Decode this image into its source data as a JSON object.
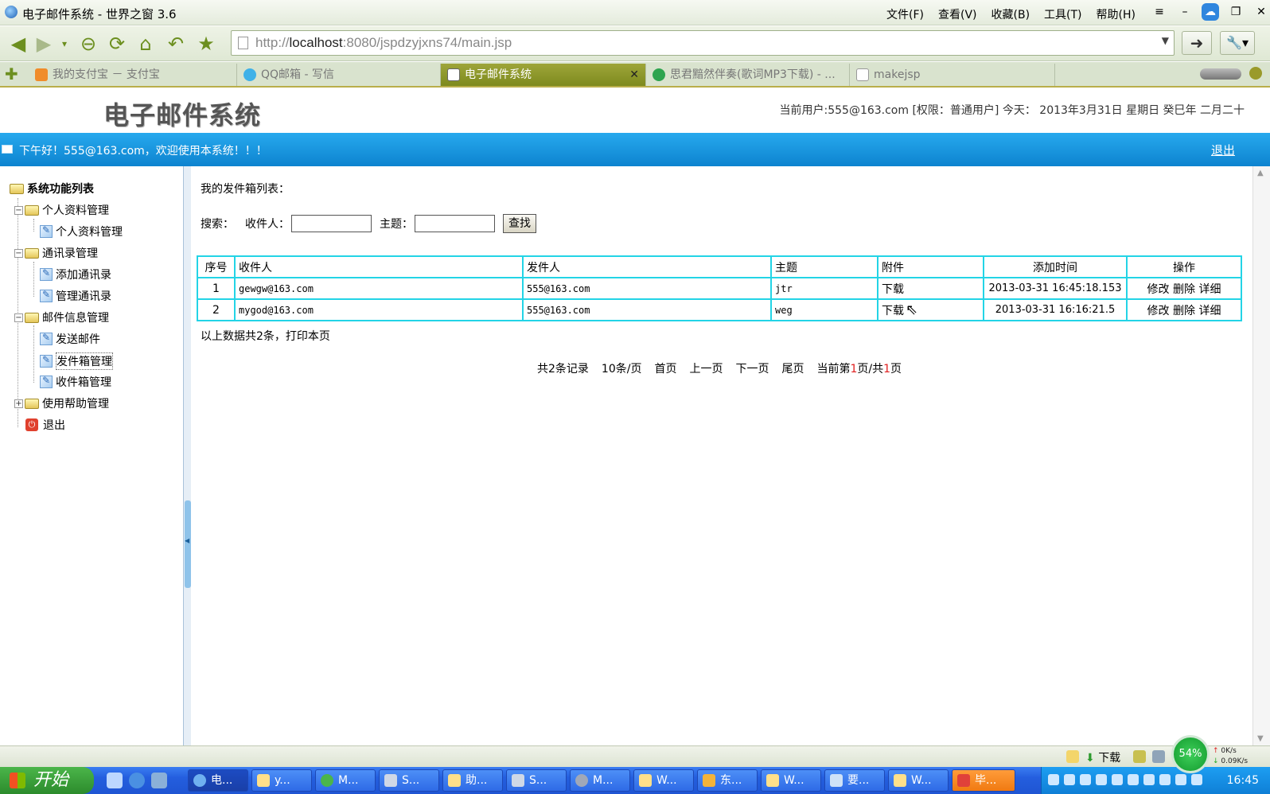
{
  "browser": {
    "title": "电子邮件系统 - 世界之窗 3.6",
    "menus": [
      "文件(F)",
      "查看(V)",
      "收藏(B)",
      "工具(T)",
      "帮助(H)"
    ],
    "url_prefix": "http://",
    "url_host": "localhost",
    "url_rest": ":8080/jspdzyjxns74/main.jsp",
    "tabs": [
      {
        "label": "我的支付宝 － 支付宝",
        "icon": "alipay-icon"
      },
      {
        "label": "QQ邮箱 - 写信",
        "icon": "qq-mail-icon"
      },
      {
        "label": "电子邮件系统",
        "icon": "page-icon",
        "active": true
      },
      {
        "label": "思君黯然伴奏(歌词MP3下载) - ...",
        "icon": "music-icon"
      },
      {
        "label": "makejsp",
        "icon": "page-icon"
      }
    ]
  },
  "site": {
    "logo": "电子邮件系统",
    "userinfo": "当前用户:555@163.com [权限：普通用户] 今天： 2013年3月31日 星期日 癸巳年 二月二十",
    "welcome": "下午好！555@163.com，欢迎使用本系统！！！",
    "logout": "退出"
  },
  "sidebar": {
    "root": "系统功能列表",
    "groups": [
      {
        "label": "个人资料管理",
        "items": [
          "个人资料管理"
        ]
      },
      {
        "label": "通讯录管理",
        "items": [
          "添加通讯录",
          "管理通讯录"
        ]
      },
      {
        "label": "邮件信息管理",
        "items": [
          "发送邮件",
          "发件箱管理",
          "收件箱管理"
        ]
      },
      {
        "label": "使用帮助管理",
        "items": []
      }
    ],
    "exit": "退出"
  },
  "main": {
    "title": "我的发件箱列表：",
    "search": {
      "label": "搜索：",
      "recipient_label": "收件人：",
      "recipient_value": "",
      "subject_label": "主题：",
      "subject_value": "",
      "button": "查找"
    },
    "table": {
      "headers": [
        "序号",
        "收件人",
        "发件人",
        "主题",
        "附件",
        "添加时间",
        "操作"
      ],
      "rows": [
        {
          "no": "1",
          "to": "gewgw@163.com",
          "from": "555@163.com",
          "subject": "jtr",
          "attach": "下载",
          "time": "2013-03-31 16:45:18.153",
          "actions": [
            "修改",
            "删除",
            "详细"
          ]
        },
        {
          "no": "2",
          "to": "mygod@163.com",
          "from": "555@163.com",
          "subject": "weg",
          "attach": "下载",
          "time": "2013-03-31 16:16:21.5",
          "actions": [
            "修改",
            "删除",
            "详细"
          ]
        }
      ]
    },
    "summary": "以上数据共2条，打印本页",
    "pager": {
      "total": "共2条记录",
      "per_page": "10条/页",
      "first": "首页",
      "prev": "上一页",
      "next": "下一页",
      "last": "尾页",
      "current_prefix": "当前第",
      "current_page": "1",
      "current_mid": "页/共",
      "total_pages": "1",
      "current_suffix": "页"
    }
  },
  "statusbar": {
    "download": "下载",
    "gauge": "54%",
    "up": "0K/s",
    "down": "0.09K/s"
  },
  "taskbar": {
    "start": "开始",
    "tasks": [
      "电...",
      "y...",
      "M...",
      "S...",
      "助...",
      "S...",
      "M...",
      "W...",
      "东...",
      "W...",
      "要...",
      "W...",
      "毕..."
    ],
    "clock": "16:45"
  },
  "colors": {
    "accent": "#0d83cf",
    "table_border": "#23d4e6",
    "tab_active": "#8a961f"
  }
}
